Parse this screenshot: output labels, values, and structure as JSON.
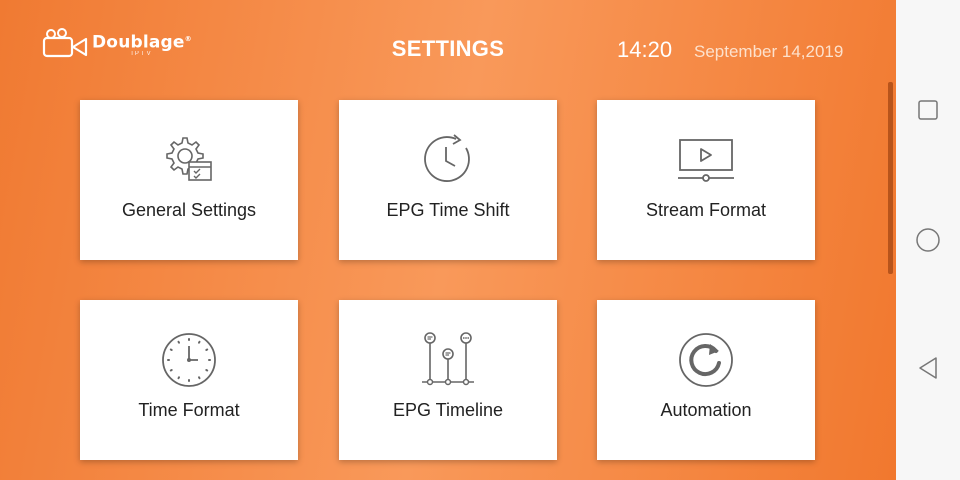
{
  "app": {
    "logo_text": "Doublage",
    "logo_sub": "IPTV",
    "logo_mark": "®",
    "title": "SETTINGS",
    "time": "14:20",
    "date": "September 14,2019",
    "accent_color": "#f58a44"
  },
  "cards": [
    {
      "label": "General Settings",
      "icon": "gear-icon"
    },
    {
      "label": "EPG Time Shift",
      "icon": "clock-refresh-icon"
    },
    {
      "label": "Stream Format",
      "icon": "video-player-icon"
    },
    {
      "label": "Time Format",
      "icon": "clock-icon"
    },
    {
      "label": "EPG Timeline",
      "icon": "timeline-icon"
    },
    {
      "label": "Automation",
      "icon": "refresh-icon"
    }
  ],
  "nav": {
    "buttons": [
      "recent-apps-icon",
      "home-icon",
      "back-icon"
    ]
  }
}
